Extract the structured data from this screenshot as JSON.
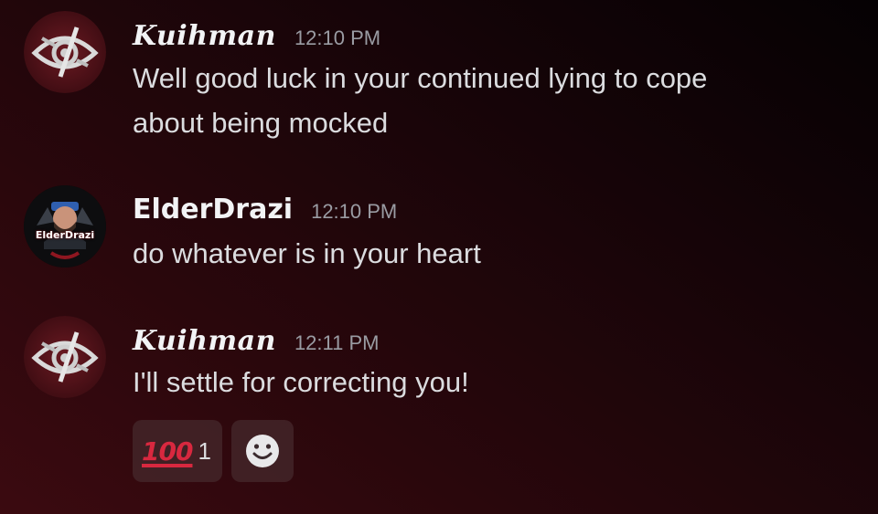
{
  "messages": [
    {
      "username": "Kuihman",
      "timestamp": "12:10 PM",
      "avatar": "eye-emblem-avatar",
      "lines": [
        "Well good luck in your continued lying to cope",
        "about being mocked"
      ]
    },
    {
      "username": "ElderDrazi",
      "timestamp": "12:10 PM",
      "avatar": "elderdrazi-avatar",
      "avatar_text": "ElderDrazi",
      "lines": [
        "do whatever is in your heart"
      ]
    },
    {
      "username": "Kuihman",
      "timestamp": "12:11 PM",
      "avatar": "eye-emblem-avatar",
      "lines": [
        "I'll settle for correcting you!"
      ]
    }
  ],
  "reactions": [
    {
      "emoji": "100",
      "emoji_name": "hundred-points-emoji",
      "count": "1"
    },
    {
      "emoji_name": "add-reaction-smile-icon"
    }
  ],
  "colors": {
    "accent_red": "#d8283f",
    "username": "#f2f3f5",
    "timestamp": "#9a9ca3"
  }
}
